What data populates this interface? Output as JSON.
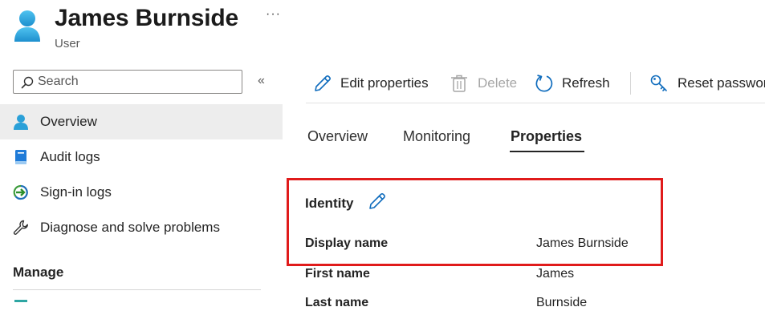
{
  "header": {
    "title": "James Burnside",
    "subtitle": "User",
    "more_label": "···"
  },
  "search": {
    "placeholder": "Search",
    "value": ""
  },
  "sidebar": {
    "collapse_label": "«",
    "items": [
      {
        "label": "Overview",
        "icon": "user-icon",
        "selected": true
      },
      {
        "label": "Audit logs",
        "icon": "book-icon",
        "selected": false
      },
      {
        "label": "Sign-in logs",
        "icon": "sign-in-icon",
        "selected": false
      },
      {
        "label": "Diagnose and solve problems",
        "icon": "wrench-icon",
        "selected": false
      }
    ],
    "section_heading": "Manage"
  },
  "toolbar": {
    "edit_properties": "Edit properties",
    "delete": "Delete",
    "refresh": "Refresh",
    "reset_password": "Reset password"
  },
  "tabs": [
    {
      "label": "Overview",
      "active": false
    },
    {
      "label": "Monitoring",
      "active": false
    },
    {
      "label": "Properties",
      "active": true
    }
  ],
  "properties": {
    "section_title": "Identity",
    "rows": [
      {
        "label": "Display name",
        "value": "James Burnside"
      },
      {
        "label": "First name",
        "value": "James"
      },
      {
        "label": "Last name",
        "value": "Burnside"
      }
    ]
  },
  "colors": {
    "accent": "#0f6cbd",
    "user_icon": "#2aa0d8",
    "highlight_border": "#e01b1b",
    "selected_nav_bg": "#ededed"
  }
}
